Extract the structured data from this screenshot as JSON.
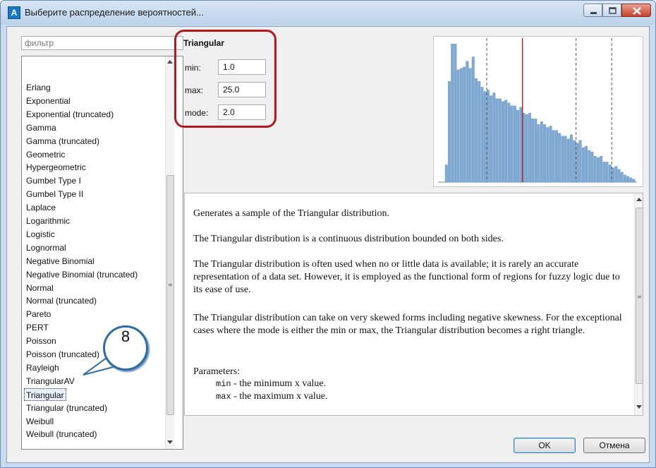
{
  "window": {
    "title": "Выберите распределение вероятностей...",
    "icon_label": "A"
  },
  "filter": {
    "placeholder": "фильтр"
  },
  "distribution_list": {
    "items": [
      "Erlang",
      "Exponential",
      "Exponential (truncated)",
      "Gamma",
      "Gamma (truncated)",
      "Geometric",
      "Hypergeometric",
      "Gumbel Type I",
      "Gumbel Type II",
      "Laplace",
      "Logarithmic",
      "Logistic",
      "Lognormal",
      "Negative Binomial",
      "Negative Binomial (truncated)",
      "Normal",
      "Normal (truncated)",
      "Pareto",
      "PERT",
      "Poisson",
      "Poisson (truncated)",
      "Rayleigh",
      "TriangularAV",
      "Triangular",
      "Triangular (truncated)",
      "Weibull",
      "Weibull (truncated)"
    ],
    "selected_index": 23
  },
  "params": {
    "title": "Triangular",
    "fields": [
      {
        "label": "min:",
        "value": "1.0"
      },
      {
        "label": "max:",
        "value": "25.0"
      },
      {
        "label": "mode:",
        "value": "2.0"
      }
    ]
  },
  "description": {
    "paragraphs": [
      "Generates a sample of the Triangular distribution.",
      "The Triangular distribution is a continuous distribution bounded on both sides.",
      "The Triangular distribution is often used when no or little data is available; it is rarely an accurate representation of a data set. However, it is employed as the functional form of regions for fuzzy logic due to its ease of use.",
      "The Triangular distribution can take on very skewed forms including negative skewness. For the exceptional cases where the mode is either the min or max, the Triangular distribution becomes a right triangle.",
      "Parameters:"
    ],
    "param_lines": [
      {
        "code": "min",
        "text": " - the minimum x value."
      },
      {
        "code": "max",
        "text": " - the maximum x value."
      }
    ]
  },
  "callout": {
    "number": "8"
  },
  "buttons": {
    "ok": "OK",
    "cancel": "Отмена"
  },
  "colors": {
    "bar": "#7fa9d2",
    "mean_line": "#b12a2a",
    "highlight": "#b5181f"
  },
  "chart_data": {
    "type": "bar",
    "bins": 64,
    "values": [
      12,
      70,
      96,
      96,
      78,
      79,
      80,
      84,
      79,
      87,
      72,
      70,
      66,
      63,
      64,
      60,
      62,
      58,
      58,
      56,
      57,
      55,
      53,
      53,
      50,
      52,
      48,
      47,
      48,
      44,
      44,
      40,
      42,
      40,
      38,
      39,
      36,
      36,
      34,
      32,
      32,
      30,
      33,
      29,
      27,
      29,
      24,
      25,
      22,
      21,
      18,
      17,
      18,
      14,
      14,
      12,
      10,
      11,
      9,
      7,
      5,
      4,
      3,
      2
    ],
    "ylim": [
      0,
      100
    ],
    "mean_bin": 26,
    "quartile_bins": [
      14,
      44,
      56
    ],
    "grid": true
  }
}
